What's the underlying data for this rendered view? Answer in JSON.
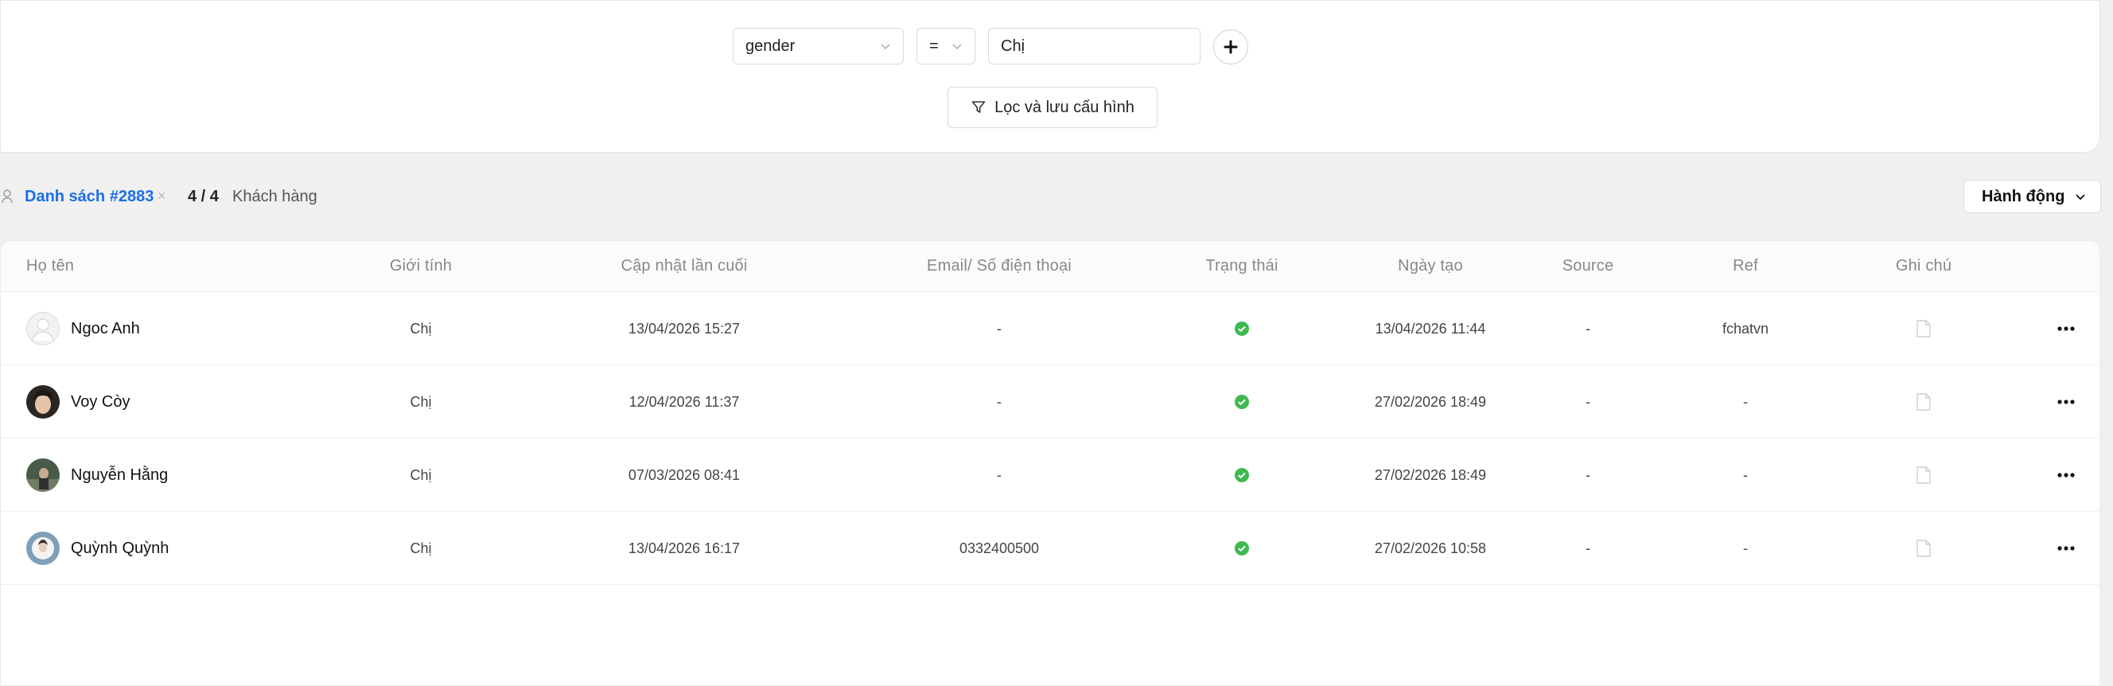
{
  "filter": {
    "field": "gender",
    "operator": "=",
    "value": "Chị",
    "apply_label": "Lọc và lưu cấu hình"
  },
  "list": {
    "name": "Danh sách #2883",
    "remove": "×",
    "count": "4 /  4",
    "count_label": "Khách hàng",
    "actions_label": "Hành động"
  },
  "table": {
    "headers": [
      "Họ tên",
      "Giới tính",
      "Cập nhật lần cuối",
      "Email/ Số điện thoại",
      "Trạng thái",
      "Ngày tạo",
      "Source",
      "Ref",
      "Ghi chú"
    ],
    "rows": [
      {
        "name": "Ngoc Anh",
        "gender": "Chị",
        "updated": "13/04/2026 15:27",
        "contact": "-",
        "status": "active",
        "created": "13/04/2026 11:44",
        "source": "-",
        "ref": "fchatvn",
        "avatar": "default-avatar"
      },
      {
        "name": "Voy Còy",
        "gender": "Chị",
        "updated": "12/04/2026 11:37",
        "contact": "-",
        "status": "active",
        "created": "27/02/2026 18:49",
        "source": "-",
        "ref": "-",
        "avatar": "photo-avatar"
      },
      {
        "name": "Nguyễn Hằng",
        "gender": "Chị",
        "updated": "07/03/2026 08:41",
        "contact": "-",
        "status": "active",
        "created": "27/02/2026 18:49",
        "source": "-",
        "ref": "-",
        "avatar": "photo-avatar"
      },
      {
        "name": "Quỳnh Quỳnh",
        "gender": "Chị",
        "updated": "13/04/2026 16:17",
        "contact": "0332400500",
        "status": "active",
        "created": "27/02/2026 10:58",
        "source": "-",
        "ref": "-",
        "avatar": "photo-avatar"
      }
    ]
  },
  "colors": {
    "accent": "#1b6ee8",
    "status_active": "#3fb950",
    "background": "#f0f0f0"
  }
}
